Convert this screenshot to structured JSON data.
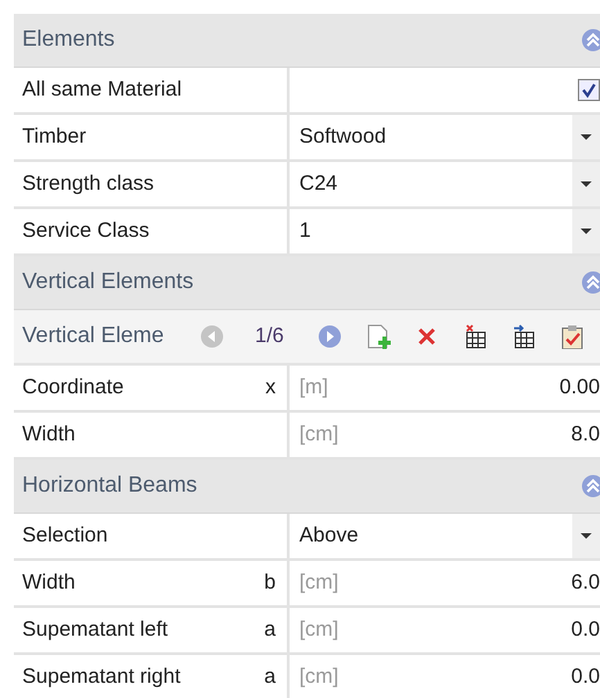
{
  "sections": [
    {
      "title": "Elements",
      "expanded": true,
      "rows": [
        {
          "kind": "checkbox",
          "label": "All same Material",
          "checked": true
        },
        {
          "kind": "dropdown",
          "label": "Timber",
          "value": "Softwood"
        },
        {
          "kind": "dropdown",
          "label": "Strength class",
          "value": "C24"
        },
        {
          "kind": "dropdown",
          "label": "Service Class",
          "value": "1"
        }
      ]
    },
    {
      "title": "Vertical Elements",
      "expanded": true,
      "navigator": {
        "label": "Vertical Eleme",
        "position": "1/6"
      },
      "rows": [
        {
          "kind": "value",
          "label": "Coordinate",
          "symbol": "x",
          "unit": "[m]",
          "value": "0.00"
        },
        {
          "kind": "value",
          "label": "Width",
          "unit": "[cm]",
          "value": "8.0"
        }
      ]
    },
    {
      "title": "Horizontal Beams",
      "expanded": true,
      "rows": [
        {
          "kind": "dropdown",
          "label": "Selection",
          "value": "Above"
        },
        {
          "kind": "value",
          "label": "Width",
          "symbol": "b",
          "unit": "[cm]",
          "value": "6.0"
        },
        {
          "kind": "value",
          "label": "Supematant left",
          "symbol": "a",
          "unit": "[cm]",
          "value": "0.0"
        },
        {
          "kind": "value",
          "label": "Supematant right",
          "symbol": "a",
          "unit": "[cm]",
          "value": "0.0"
        }
      ]
    }
  ]
}
